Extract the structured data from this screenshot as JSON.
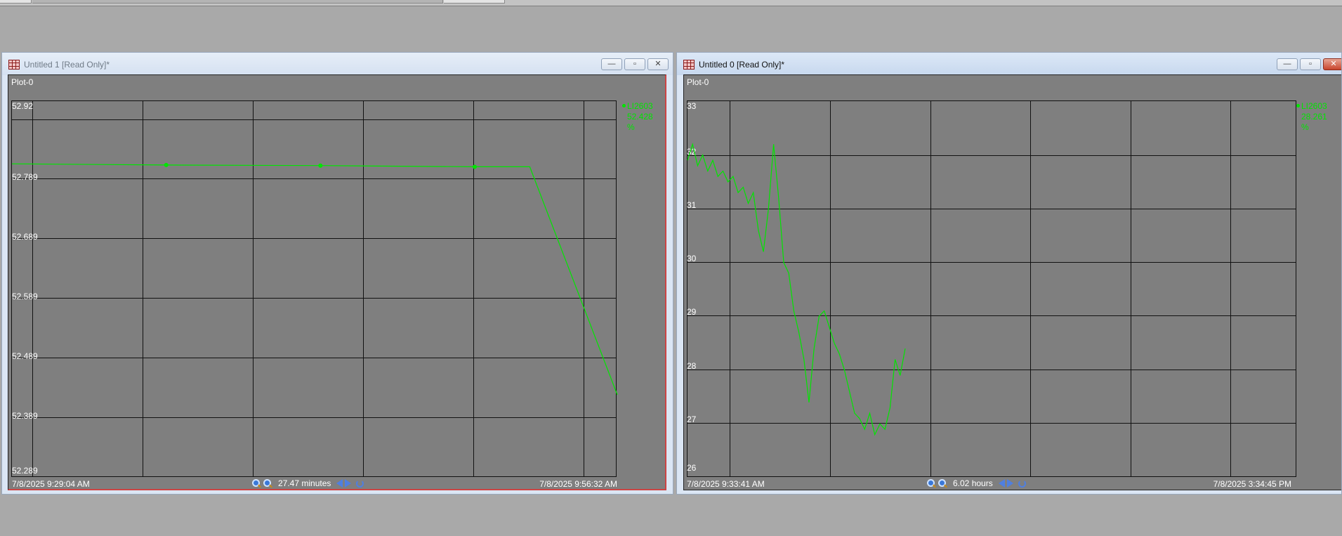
{
  "windows": [
    {
      "id": "w1",
      "title": "Untitled 1 [Read Only]*",
      "active": false,
      "plot_label": "Plot-0",
      "legend": {
        "tag": "LI2603",
        "value": "52.428",
        "unit": "%"
      },
      "footer": {
        "start": "7/8/2025 9:29:04 AM",
        "duration": "27.47 minutes",
        "end": "7/8/2025 9:56:32 AM"
      },
      "y_ticks": [
        "52.92",
        "52.789",
        "52.689",
        "52.589",
        "52.489",
        "52.389",
        "52.289"
      ]
    },
    {
      "id": "w2",
      "title": "Untitled 0 [Read Only]*",
      "active": true,
      "plot_label": "Plot-0",
      "legend": {
        "tag": "LI2603",
        "value": "28.261",
        "unit": "%"
      },
      "footer": {
        "start": "7/8/2025 9:33:41 AM",
        "duration": "6.02 hours",
        "end": "7/8/2025 3:34:45 PM"
      },
      "y_ticks": [
        "33",
        "32",
        "31",
        "30",
        "29",
        "28",
        "27",
        "26"
      ]
    }
  ],
  "window_buttons": {
    "minimize": "—",
    "maximize": "▫",
    "close": "✕"
  },
  "colors": {
    "trend": "#00e600",
    "plot_bg": "#7f7f7f",
    "gridline": "#111111"
  },
  "chart_data": [
    {
      "type": "line",
      "series": [
        {
          "name": "LI2603",
          "x_minutes": [
            0,
            7.0,
            14.0,
            21.0,
            23.5,
            27.47
          ],
          "y": [
            52.815,
            52.813,
            52.812,
            52.81,
            52.81,
            52.428
          ]
        }
      ],
      "markers_at_minutes": [
        7.0,
        14.0,
        21.0
      ],
      "xlim_labels": [
        "7/8/2025 9:29:04 AM",
        "7/8/2025 9:56:32 AM"
      ],
      "ylim": [
        52.289,
        52.92
      ],
      "grid": true
    },
    {
      "type": "line",
      "series": [
        {
          "name": "LI2603",
          "x_hours": [
            0,
            0.05,
            0.1,
            0.15,
            0.2,
            0.25,
            0.3,
            0.35,
            0.4,
            0.45,
            0.5,
            0.55,
            0.6,
            0.65,
            0.7,
            0.75,
            0.8,
            0.85,
            0.9,
            0.95,
            1.0,
            1.05,
            1.1,
            1.15,
            1.2,
            1.25,
            1.3,
            1.35,
            1.4,
            1.45,
            1.5,
            1.55,
            1.6,
            1.65,
            1.7,
            1.75,
            1.8,
            1.85,
            1.9,
            1.95,
            2.0,
            2.05,
            2.1,
            2.15
          ],
          "y": [
            31.9,
            32.2,
            31.8,
            32.0,
            31.7,
            31.9,
            31.6,
            31.7,
            31.5,
            31.6,
            31.3,
            31.4,
            31.1,
            31.3,
            30.6,
            30.2,
            31.0,
            32.2,
            31.2,
            30.0,
            29.8,
            29.1,
            28.7,
            28.2,
            27.4,
            28.4,
            29.0,
            29.1,
            28.8,
            28.5,
            28.3,
            28.0,
            27.6,
            27.2,
            27.1,
            26.9,
            27.2,
            26.8,
            27.0,
            26.9,
            27.3,
            28.2,
            27.9,
            28.4
          ]
        }
      ],
      "xlim_labels": [
        "7/8/2025 9:33:41 AM",
        "7/8/2025 3:34:45 PM"
      ],
      "ylim": [
        26,
        33
      ],
      "grid": true
    }
  ]
}
